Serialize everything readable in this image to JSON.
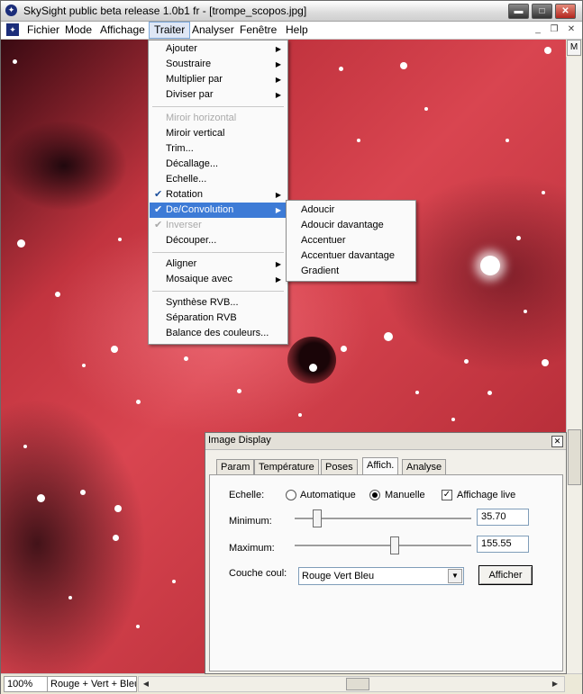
{
  "window": {
    "title": "SkySight public beta release 1.0b1 fr - [trompe_scopos.jpg]",
    "app_icon": "skysight-icon",
    "controls": {
      "minimize": "▬",
      "maximize": "□",
      "close": "✕"
    }
  },
  "menubar": {
    "items": [
      "Fichier",
      "Mode",
      "Affichage",
      "Traiter",
      "Analyser",
      "Fenêtre",
      "Help"
    ],
    "active": "Traiter",
    "mdi_controls": {
      "minimize": "_",
      "restore": "❐",
      "close": "✕"
    }
  },
  "side_button": "M",
  "traiter_menu": {
    "items": [
      {
        "label": "Ajouter",
        "submenu": true,
        "disabled": false,
        "checked": false
      },
      {
        "label": "Soustraire",
        "submenu": true,
        "disabled": false,
        "checked": false
      },
      {
        "label": "Multiplier par",
        "submenu": true,
        "disabled": false,
        "checked": false
      },
      {
        "label": "Diviser par",
        "submenu": true,
        "disabled": false,
        "checked": false
      },
      {
        "label": "Miroir horizontal",
        "submenu": false,
        "disabled": true,
        "checked": false
      },
      {
        "label": "Miroir vertical",
        "submenu": false,
        "disabled": false,
        "checked": false
      },
      {
        "label": "Trim...",
        "submenu": false,
        "disabled": false,
        "checked": false
      },
      {
        "label": "Décallage...",
        "submenu": false,
        "disabled": false,
        "checked": false
      },
      {
        "label": "Echelle...",
        "submenu": false,
        "disabled": false,
        "checked": false
      },
      {
        "label": "Rotation",
        "submenu": true,
        "disabled": false,
        "checked": true
      },
      {
        "label": "De/Convolution",
        "submenu": true,
        "disabled": false,
        "checked": true,
        "highlighted": true
      },
      {
        "label": "Inverser",
        "submenu": false,
        "disabled": true,
        "checked": true
      },
      {
        "label": "Découper...",
        "submenu": false,
        "disabled": false,
        "checked": false
      },
      {
        "label": "Aligner",
        "submenu": true,
        "disabled": false,
        "checked": false
      },
      {
        "label": "Mosaique avec",
        "submenu": true,
        "disabled": false,
        "checked": false
      },
      {
        "label": "Synthèse RVB...",
        "submenu": false,
        "disabled": false,
        "checked": false
      },
      {
        "label": "Séparation RVB",
        "submenu": false,
        "disabled": false,
        "checked": false
      },
      {
        "label": "Balance des couleurs...",
        "submenu": false,
        "disabled": false,
        "checked": false
      }
    ]
  },
  "convolution_submenu": {
    "items": [
      "Adoucir",
      "Adoucir davantage",
      "Accentuer",
      "Accentuer davantage",
      "Gradient"
    ]
  },
  "image_display": {
    "title": "Image Display",
    "tabs": [
      "Param",
      "Température",
      "Poses",
      "Affich.",
      "Analyse"
    ],
    "active_tab": "Affich.",
    "echelle_label": "Echelle:",
    "radio_auto": "Automatique",
    "radio_manual": "Manuelle",
    "selected_mode": "Manuelle",
    "live_label": "Affichage live",
    "live_checked": true,
    "minimum_label": "Minimum:",
    "minimum_value": "35.70",
    "minimum_slider": 0.12,
    "maximum_label": "Maximum:",
    "maximum_value": "155.55",
    "maximum_slider": 0.56,
    "couche_label": "Couche coul:",
    "couche_value": "Rouge Vert Bleu",
    "afficher_button": "Afficher"
  },
  "statusbar": {
    "zoom": "100%",
    "channel": "Rouge + Vert + Bleu"
  },
  "colors": {
    "menu_highlight": "#3d7bd6",
    "nebula_red": "#c2343f"
  }
}
